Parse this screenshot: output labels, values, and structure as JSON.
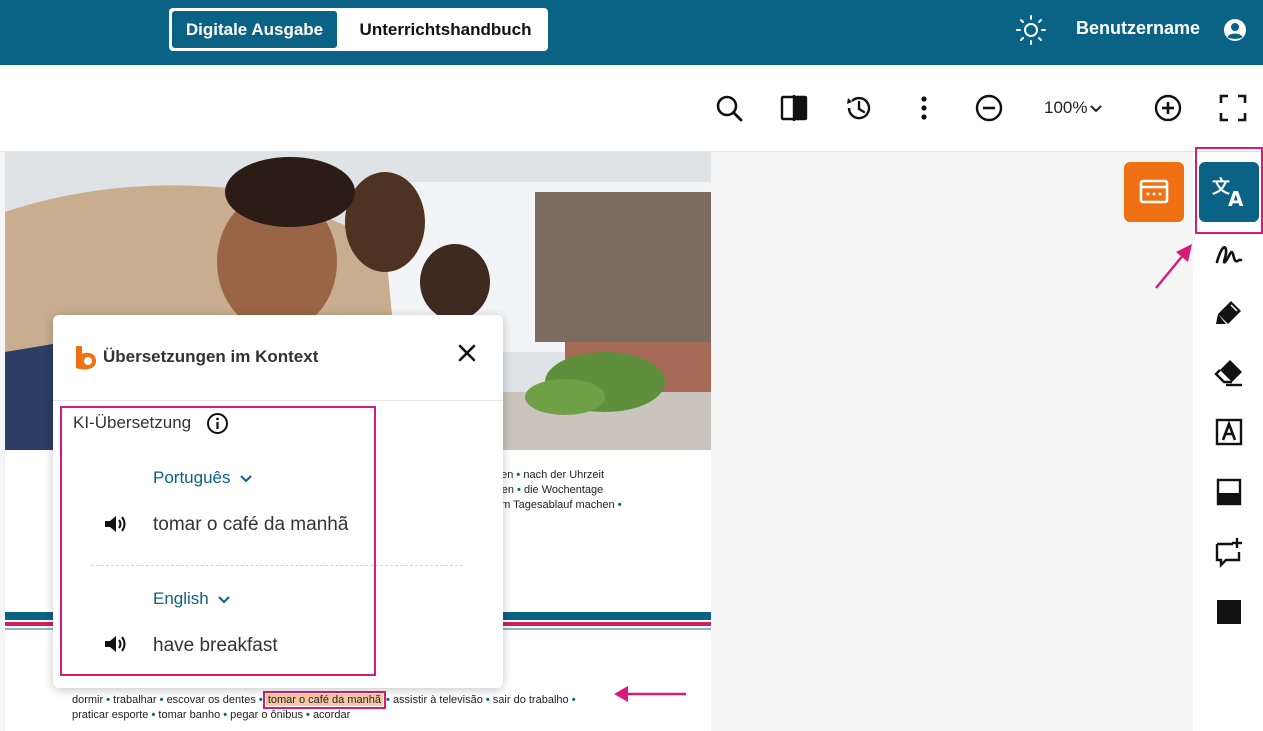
{
  "header": {
    "tabs": [
      {
        "label": "Digitale Ausgabe",
        "active": true
      },
      {
        "label": "Unterrichtshandbuch",
        "active": false
      }
    ],
    "theme_icon": "sun-icon",
    "username": "Benutzername",
    "user_icon": "user-circle-icon"
  },
  "toolbar": {
    "icons": [
      "search-icon",
      "book-view-icon",
      "history-icon",
      "more-vertical-icon",
      "zoom-out-icon",
      "zoom-in-icon",
      "fullscreen-icon"
    ],
    "zoom_level": "100%"
  },
  "page": {
    "vocab_top": [
      "ben",
      "nach der Uhrzeit",
      "rten",
      "die Wochentage",
      "um Tagesablauf machen"
    ],
    "vocab_bottom_line1": [
      "dormir",
      "trabalhar",
      "escovar os dentes",
      "tomar o café da manhã",
      "assistir à televisão",
      "sair do trabalho"
    ],
    "vocab_bottom_line2": [
      "praticar esporte",
      "tomar banho",
      "pegar o ônibus",
      "acordar"
    ]
  },
  "sidebar": {
    "tools": [
      "keyboard-icon",
      "translate-icon",
      "freehand-pen-icon",
      "highlighter-icon",
      "eraser-icon",
      "text-box-icon",
      "bookmark-icon",
      "add-comment-icon",
      "black-square-icon"
    ]
  },
  "popup": {
    "title": "Übersetzungen im Kontext",
    "ai_label": "KI-Übersetzung",
    "translations": [
      {
        "language": "Português",
        "text": "tomar o café da manhã"
      },
      {
        "language": "English",
        "text": "have breakfast"
      }
    ]
  },
  "colors": {
    "brand": "#0a6285",
    "accent_orange": "#f07113",
    "annotation_pink": "#d81b7b",
    "highlight": "#f6c9a4"
  }
}
